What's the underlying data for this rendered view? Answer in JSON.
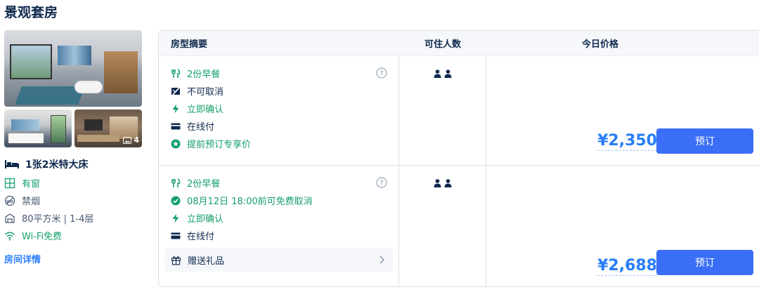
{
  "room": {
    "title": "景观套房",
    "photo_count": "4",
    "bed": "1张2米特大床",
    "amenities": [
      {
        "icon": "window-icon",
        "label": "有窗",
        "green": true
      },
      {
        "icon": "no-smoking-icon",
        "label": "禁烟",
        "green": false
      },
      {
        "icon": "area-icon",
        "label": "80平方米 | 1-4层",
        "green": false
      },
      {
        "icon": "wifi-icon",
        "label": "Wi-Fi免费",
        "green": true
      }
    ],
    "detail_link": "房间详情"
  },
  "table": {
    "headers": {
      "summary": "房型摘要",
      "guests": "可住人数",
      "price": "今日价格"
    },
    "rows": [
      {
        "features": [
          {
            "icon": "breakfast-icon",
            "label": "2份早餐",
            "green": true
          },
          {
            "icon": "no-cancel-icon",
            "label": "不可取消",
            "green": false
          },
          {
            "icon": "lightning-icon",
            "label": "立即确认",
            "green": true
          },
          {
            "icon": "card-icon",
            "label": "在线付",
            "green": false
          },
          {
            "icon": "star-badge-icon",
            "label": "提前预订专享价",
            "green": true
          }
        ],
        "guests": 2,
        "price": "¥2,350",
        "book_label": "预订"
      },
      {
        "features": [
          {
            "icon": "breakfast-icon",
            "label": "2份早餐",
            "green": true
          },
          {
            "icon": "check-circle-icon",
            "label": "08月12日 18:00前可免费取消",
            "green": true
          },
          {
            "icon": "lightning-icon",
            "label": "立即确认",
            "green": true
          },
          {
            "icon": "card-icon",
            "label": "在线付",
            "green": false
          }
        ],
        "gift_label": "赠送礼品",
        "guests": 2,
        "price": "¥2,688",
        "book_label": "预订"
      }
    ]
  },
  "colors": {
    "accent": "#287dfa",
    "green": "#16a06a",
    "button": "#3a6ef6",
    "text": "#0f294d"
  }
}
